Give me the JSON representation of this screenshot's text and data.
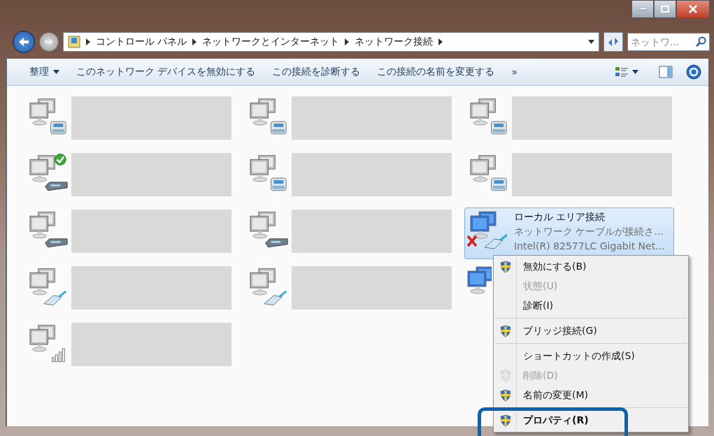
{
  "address_bar": {
    "path": [
      "コントロール パネル",
      "ネットワークとインターネット",
      "ネットワーク接続"
    ],
    "search": {
      "placeholder": "ネットワ..."
    }
  },
  "toolbar": {
    "organize": "整理",
    "commands": [
      "このネットワーク デバイスを無効にする",
      "この接続を診断する",
      "この接続の名前を変更する"
    ],
    "more": "»"
  },
  "connections": [
    {
      "kind": "phone",
      "connected": false,
      "error": false,
      "active": false,
      "redacted": true,
      "selected": false
    },
    {
      "kind": "phone",
      "connected": false,
      "error": false,
      "active": false,
      "redacted": true,
      "selected": false
    },
    {
      "kind": "phone",
      "connected": false,
      "error": false,
      "active": false,
      "redacted": true,
      "selected": false
    },
    {
      "kind": "modem",
      "connected": true,
      "error": false,
      "active": false,
      "redacted": true,
      "selected": false
    },
    {
      "kind": "phone",
      "connected": false,
      "error": false,
      "active": false,
      "redacted": true,
      "selected": false
    },
    {
      "kind": "phone",
      "connected": false,
      "error": false,
      "active": false,
      "redacted": true,
      "selected": false
    },
    {
      "kind": "modem",
      "connected": false,
      "error": false,
      "active": false,
      "redacted": true,
      "selected": false
    },
    {
      "kind": "modem",
      "connected": false,
      "error": false,
      "active": false,
      "redacted": true,
      "selected": false
    },
    {
      "kind": "cable",
      "connected": false,
      "error": true,
      "active": true,
      "redacted": false,
      "selected": true,
      "name": "ローカル エリア接続",
      "status": "ネットワーク ケーブルが接続さ...",
      "adapter": "Intel(R) 82577LC Gigabit Net..."
    },
    {
      "kind": "cable",
      "connected": false,
      "error": false,
      "active": false,
      "redacted": true,
      "selected": false
    },
    {
      "kind": "cable",
      "connected": false,
      "error": false,
      "active": false,
      "redacted": true,
      "selected": false
    },
    {
      "kind": "cable",
      "connected": false,
      "error": false,
      "active": true,
      "redacted": false,
      "selected": false
    },
    {
      "kind": "wireless",
      "connected": false,
      "error": false,
      "active": false,
      "redacted": true,
      "selected": false
    }
  ],
  "callout_outline": true,
  "context_menu": [
    {
      "label": "無効にする(B)",
      "shield": true,
      "disabled": false,
      "bold": false,
      "separator_after": false
    },
    {
      "label": "状態(U)",
      "shield": false,
      "disabled": true,
      "bold": false,
      "separator_after": false
    },
    {
      "label": "診断(I)",
      "shield": false,
      "disabled": false,
      "bold": false,
      "separator_after": true
    },
    {
      "label": "ブリッジ接続(G)",
      "shield": true,
      "disabled": false,
      "bold": false,
      "separator_after": true
    },
    {
      "label": "ショートカットの作成(S)",
      "shield": false,
      "disabled": false,
      "bold": false,
      "separator_after": false
    },
    {
      "label": "削除(D)",
      "shield": true,
      "disabled": true,
      "bold": false,
      "separator_after": false
    },
    {
      "label": "名前の変更(M)",
      "shield": true,
      "disabled": false,
      "bold": false,
      "separator_after": true
    },
    {
      "label": "プロパティ(R)",
      "shield": true,
      "disabled": false,
      "bold": true,
      "separator_after": false
    }
  ]
}
